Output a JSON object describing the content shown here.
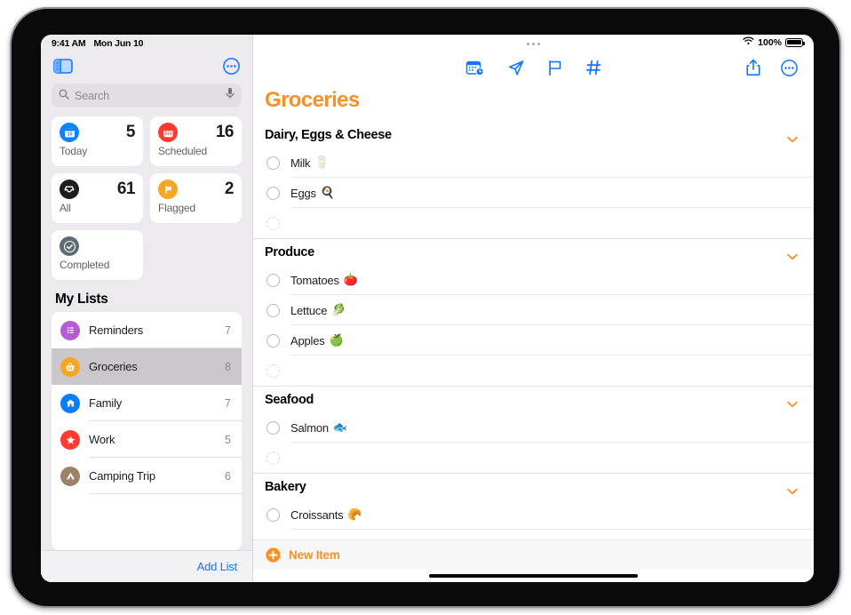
{
  "statusbar": {
    "time": "9:41 AM",
    "date": "Mon Jun 10",
    "battery_percent": "100%",
    "wifi_icon": "wifi-icon",
    "battery_icon": "battery-full-icon"
  },
  "sidebar": {
    "toggle_icon": "sidebar-toggle-icon",
    "more_icon": "more-circle-icon",
    "search": {
      "placeholder": "Search",
      "value": "",
      "search_icon": "magnifier-icon",
      "mic_icon": "microphone-icon"
    },
    "smart_lists": [
      {
        "label": "Today",
        "count": "5",
        "icon": "calendar-day-icon",
        "color": "#0A84FF"
      },
      {
        "label": "Scheduled",
        "count": "16",
        "icon": "calendar-icon",
        "color": "#FF3B30"
      },
      {
        "label": "All",
        "count": "61",
        "icon": "inbox-tray-icon",
        "color": "#1C1C1E"
      },
      {
        "label": "Flagged",
        "count": "2",
        "icon": "flag-icon",
        "color": "#F5A623"
      },
      {
        "label": "Completed",
        "count": "",
        "icon": "checkmark-icon",
        "color": "#5E6B73"
      }
    ],
    "my_lists_title": "My Lists",
    "lists": [
      {
        "name": "Reminders",
        "count": "7",
        "icon": "bulleted-list-icon",
        "color": "#B55CD4",
        "selected": false
      },
      {
        "name": "Groceries",
        "count": "8",
        "icon": "basket-icon",
        "color": "#F5A623",
        "selected": true
      },
      {
        "name": "Family",
        "count": "7",
        "icon": "house-icon",
        "color": "#0A7CFF",
        "selected": false
      },
      {
        "name": "Work",
        "count": "5",
        "icon": "star-icon",
        "color": "#FF3B30",
        "selected": false
      },
      {
        "name": "Camping Trip",
        "count": "6",
        "icon": "tent-icon",
        "color": "#9C8268",
        "selected": false
      }
    ],
    "add_list_label": "Add List"
  },
  "main": {
    "grabber_icon": "window-grabber-icon",
    "toolbar_icons": [
      {
        "name": "calendar-badge-clock-icon"
      },
      {
        "name": "location-arrow-icon"
      },
      {
        "name": "flag-outline-icon"
      },
      {
        "name": "hashtag-icon"
      }
    ],
    "toolbar_right_icons": [
      {
        "name": "share-icon"
      },
      {
        "name": "more-circle-icon"
      }
    ],
    "title": "Groceries",
    "accent_color": "#F59227",
    "sections": [
      {
        "title": "Dairy, Eggs & Cheese",
        "chevron_icon": "chevron-down-icon",
        "items": [
          {
            "text": "Milk",
            "emoji": "🥛",
            "empty": false
          },
          {
            "text": "Eggs",
            "emoji": "🍳",
            "empty": false
          },
          {
            "text": "",
            "emoji": "",
            "empty": true
          }
        ]
      },
      {
        "title": "Produce",
        "chevron_icon": "chevron-down-icon",
        "items": [
          {
            "text": "Tomatoes",
            "emoji": "🍅",
            "empty": false
          },
          {
            "text": "Lettuce",
            "emoji": "🥬",
            "empty": false
          },
          {
            "text": "Apples",
            "emoji": "🍏",
            "empty": false
          },
          {
            "text": "",
            "emoji": "",
            "empty": true
          }
        ]
      },
      {
        "title": "Seafood",
        "chevron_icon": "chevron-down-icon",
        "items": [
          {
            "text": "Salmon",
            "emoji": "🐟",
            "empty": false
          },
          {
            "text": "",
            "emoji": "",
            "empty": true
          }
        ]
      },
      {
        "title": "Bakery",
        "chevron_icon": "chevron-down-icon",
        "items": [
          {
            "text": "Croissants",
            "emoji": "🥐",
            "empty": false
          }
        ]
      }
    ],
    "new_item": {
      "label": "New Item",
      "icon": "plus-circle-icon"
    },
    "home_indicator_icon": "home-indicator"
  }
}
